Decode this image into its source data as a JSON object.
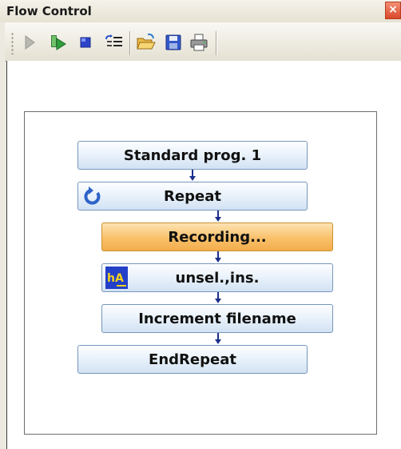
{
  "window": {
    "title": "Flow Control",
    "close_label": "×"
  },
  "toolbar": {
    "buttons": [
      {
        "name": "play-icon"
      },
      {
        "name": "step-run-icon"
      },
      {
        "name": "stop-icon"
      },
      {
        "name": "settings-list-icon"
      },
      {
        "name": "open-folder-icon"
      },
      {
        "name": "save-icon"
      },
      {
        "name": "print-icon"
      }
    ]
  },
  "flow": {
    "blocks": [
      {
        "label": "Standard prog. 1",
        "state": "normal"
      },
      {
        "label": "Repeat",
        "state": "normal",
        "icon": "repeat-icon"
      },
      {
        "label": "Recording...",
        "state": "active"
      },
      {
        "label": "unsel.,ins.",
        "state": "normal",
        "icon": "instrument-icon"
      },
      {
        "label": "Increment filename",
        "state": "normal"
      },
      {
        "label": "EndRepeat",
        "state": "normal"
      }
    ]
  },
  "colors": {
    "connector": "#1a2f8a",
    "active_block": "#f9c06a",
    "block_border": "#7796bd",
    "close_button": "#d9482a"
  }
}
